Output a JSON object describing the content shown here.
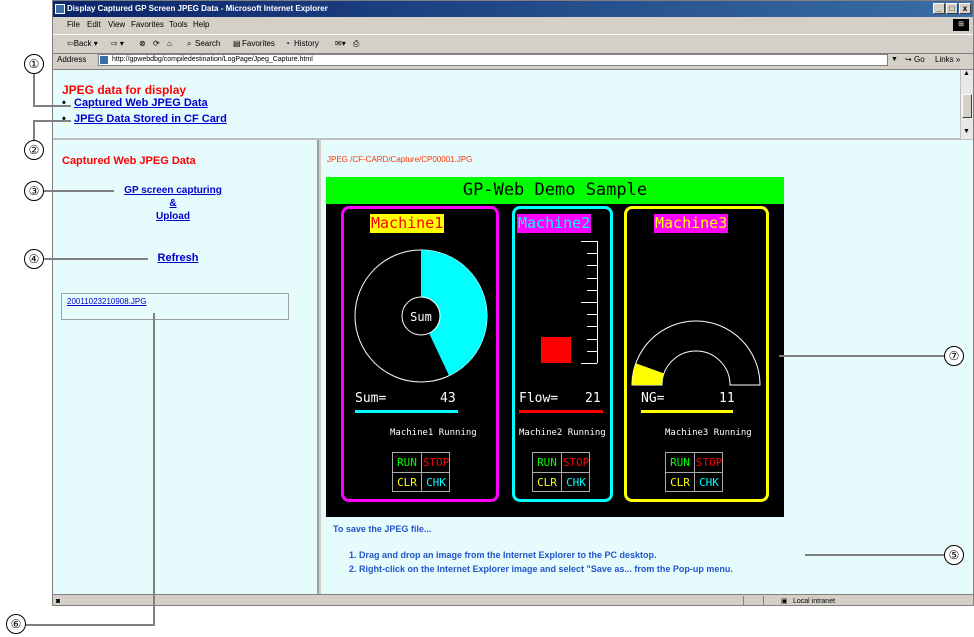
{
  "window": {
    "title": "Display Captured GP Screen JPEG Data - Microsoft Internet Explorer",
    "min": "_",
    "max": "□",
    "close": "x"
  },
  "menu": [
    "File",
    "Edit",
    "View",
    "Favorites",
    "Tools",
    "Help"
  ],
  "toolbar": {
    "back": "⇦Back ▾",
    "forward": "⇨ ▾",
    "stop": "⊗",
    "refresh": "⟳",
    "home": "⌂",
    "search": "Search",
    "favorites": "Favorites",
    "history": "History",
    "mail": "✉▾",
    "print": "⎙"
  },
  "address": {
    "label": "Address",
    "url": "http://gpwebdbg/compiledestination/LogPage/Jpeg_Capture.html",
    "go": "Go",
    "links": "Links »"
  },
  "top_frame": {
    "heading": "JPEG data for display",
    "links": [
      "Captured Web JPEG Data",
      "JPEG Data Stored in CF Card"
    ]
  },
  "left_frame": {
    "heading": "Captured Web JPEG Data",
    "capture_lines": [
      "GP screen capturing",
      "&",
      "Upload"
    ],
    "refresh": "Refresh",
    "file": "20011023210908.JPG"
  },
  "right_frame": {
    "path": "JPEG /CF-CARD/Capture/CP00001.JPG",
    "save_heading": "To save the JPEG file...",
    "steps": [
      "1.  Drag and drop an image from the Internet Explorer to the PC desktop.",
      "2.  Right-click on the Internet Explorer image and select \"Save as... from the Pop-up menu."
    ]
  },
  "gp": {
    "title": "GP-Web Demo Sample",
    "machines": [
      {
        "name": "Machine1",
        "readout_label": "Sum=",
        "readout_value": "43",
        "status": "Machine1 Running",
        "center": "Sum",
        "pie_fraction": 0.43,
        "frame": "#ff00ff",
        "label_bg": "#ffff00",
        "label_fg": "#ff0000",
        "underline": "#00ffff"
      },
      {
        "name": "Machine2",
        "readout_label": "Flow=",
        "readout_value": "21",
        "status": "Machine2 Running",
        "bar_fraction": 0.21,
        "frame": "#00ffff",
        "label_bg": "#ff00ff",
        "label_fg": "#00ffff",
        "underline": "#ff0000"
      },
      {
        "name": "Machine3",
        "readout_label": "NG=",
        "readout_value": "11",
        "status": "Machine3 Running",
        "gauge_fraction": 0.11,
        "frame": "#ffff00",
        "label_bg": "#ff00ff",
        "label_fg": "#ffff00",
        "underline": "#ffff00"
      }
    ],
    "buttons": {
      "run": "RUN",
      "stop": "STOP",
      "clr": "CLR",
      "chk": "CHK"
    }
  },
  "status": {
    "zone": "Local intranet"
  },
  "callouts": [
    "①",
    "②",
    "③",
    "④",
    "⑤",
    "⑥",
    "⑦"
  ]
}
